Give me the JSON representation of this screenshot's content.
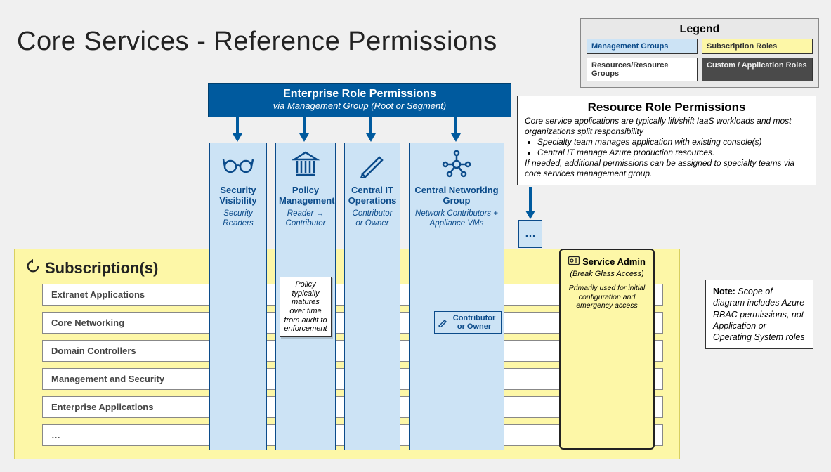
{
  "title": "Core Services - Reference Permissions",
  "legend": {
    "title": "Legend",
    "mg": "Management Groups",
    "sr": "Subscription Roles",
    "rrg": "Resources/Resource Groups",
    "car": "Custom / Application Roles"
  },
  "enterprise_bar": {
    "title": "Enterprise Role Permissions",
    "subtitle": "via Management Group (Root or Segment)"
  },
  "resource_box": {
    "title": "Resource Role Permissions",
    "intro": "Core service applications are typically lift/shift IaaS workloads and most organizations split responsibility",
    "b1": "Specialty team manages application with existing console(s)",
    "b2": "Central IT manage Azure production resources.",
    "outro": "If needed, additional permissions can be assigned to specialty teams via core services management group."
  },
  "subscriptions": {
    "header": "Subscription(s)",
    "rows": [
      "Extranet Applications",
      "Core Networking",
      "Domain Controllers",
      "Management and Security",
      "Enterprise Applications",
      "…"
    ]
  },
  "columns": {
    "sec": {
      "title": "Security Visibility",
      "sub": "Security Readers"
    },
    "pol": {
      "title": "Policy Management",
      "sub": "Reader → Contributor",
      "note": "Policy typically matures over time from audit to enforcement"
    },
    "ops": {
      "title": "Central IT Operations",
      "sub": "Contributor or Owner"
    },
    "net": {
      "title": "Central Networking Group",
      "sub": "Network Contributors + Appliance VMs",
      "badge": "Contributor or Owner"
    },
    "ellipsis": "…"
  },
  "service_admin": {
    "title": "Service Admin",
    "subtitle": "(Break Glass Access)",
    "body": "Primarily used for initial configuration and emergency access"
  },
  "side_note": {
    "label": "Note:",
    "text": " Scope of diagram includes Azure RBAC permissions, not Application or Operating System roles"
  }
}
